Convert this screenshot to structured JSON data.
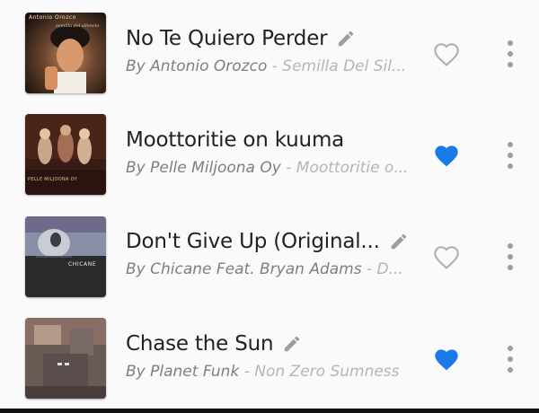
{
  "colors": {
    "background": "#fafafa",
    "title_text": "#222222",
    "artist_text": "#7f7f7f",
    "album_text": "#b5b5b5",
    "favorite_active": "#1a7be8",
    "favorite_inactive": "#b0b0b0",
    "icon_gray": "#9e9e9e"
  },
  "songs": [
    {
      "title": "No Te Quiero Perder",
      "artist": "By Antonio Orozco",
      "album": " - Semilla Del Sil...",
      "editable": true,
      "favorite": false,
      "cover_text": "Antonio Orozco",
      "cover_subtext": "semilla del silencio"
    },
    {
      "title": "Moottoritie on kuuma",
      "artist": "By Pelle Miljoona Oy",
      "album": " - Moottoritie o...",
      "editable": false,
      "favorite": true,
      "cover_text": "PELLE MILJOONA OY"
    },
    {
      "title": "Don't Give Up (Original...",
      "artist": "By Chicane Feat. Bryan Adams",
      "album": " - D...",
      "editable": true,
      "favorite": false,
      "cover_text": "CHICANE"
    },
    {
      "title": "Chase the Sun",
      "artist": "By Planet Funk",
      "album": " - Non Zero Sumness",
      "editable": true,
      "favorite": true
    }
  ]
}
